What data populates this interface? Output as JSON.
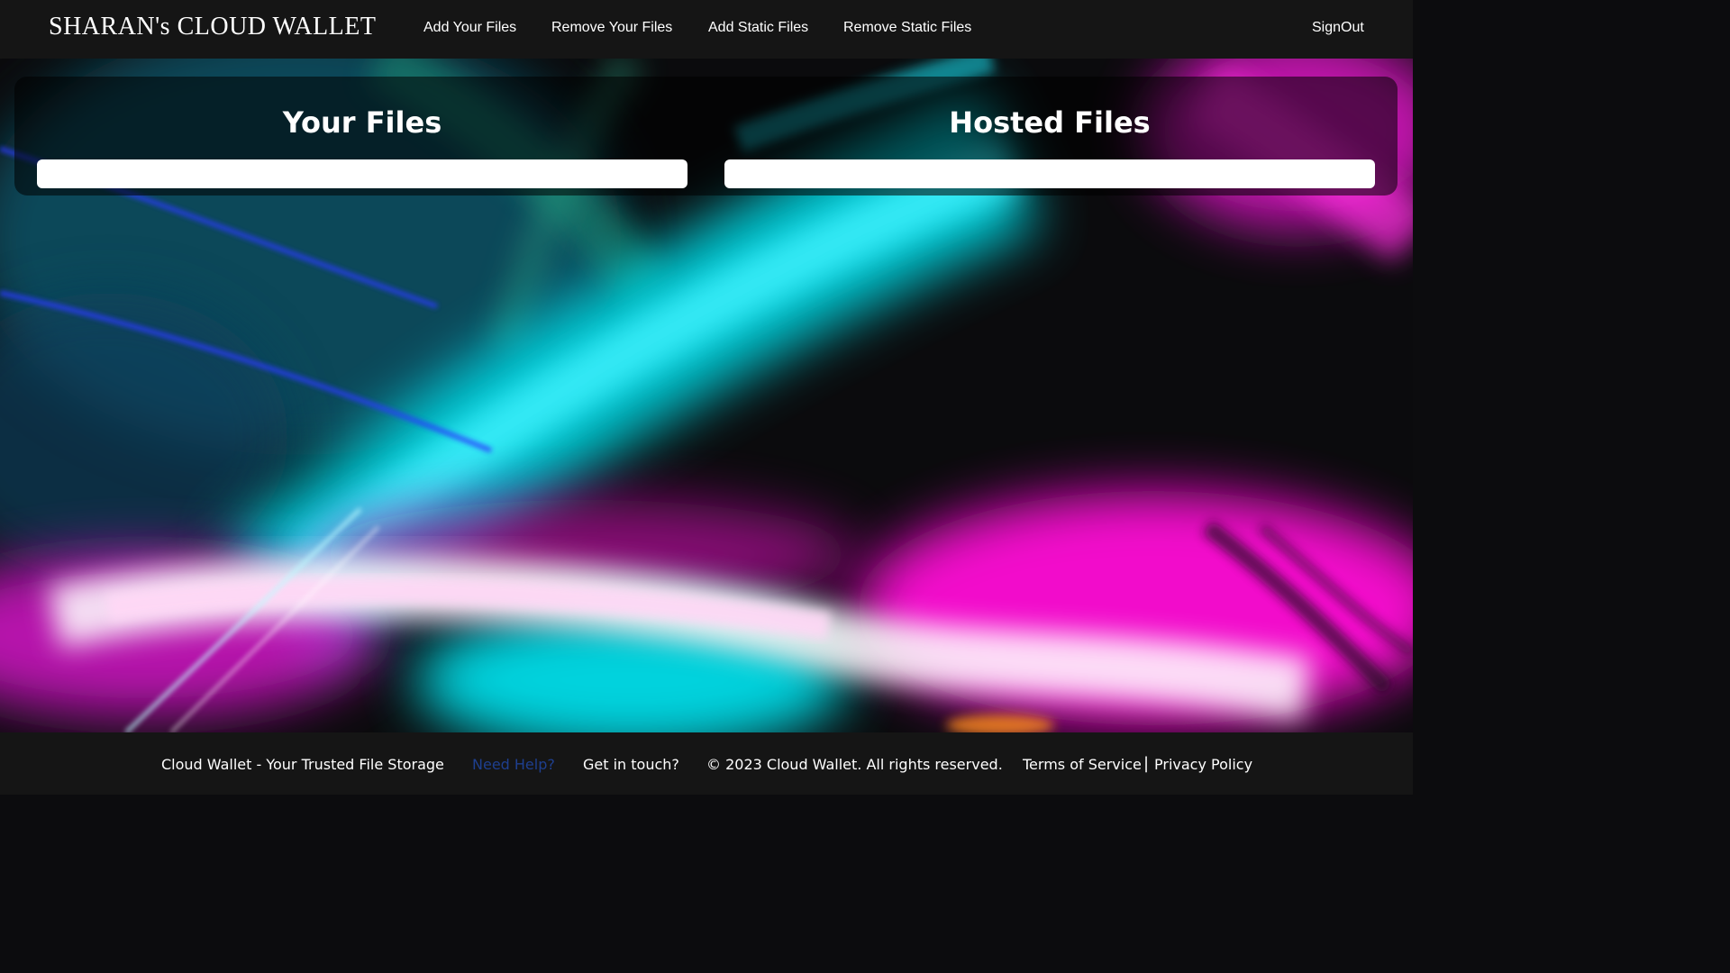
{
  "navbar": {
    "brand": "SHARAN's CLOUD WALLET",
    "links": [
      {
        "label": "Add Your Files"
      },
      {
        "label": "Remove Your Files"
      },
      {
        "label": "Add Static Files"
      },
      {
        "label": "Remove Static Files"
      }
    ],
    "signout_label": "SignOut"
  },
  "main": {
    "your_files_title": "Your Files",
    "hosted_files_title": "Hosted Files"
  },
  "footer": {
    "tagline": "Cloud Wallet - Your Trusted File Storage",
    "help_label": "Need Help?",
    "contact_label": "Get in touch?",
    "copyright": "© 2023 Cloud Wallet. All rights reserved.",
    "terms_label": "Terms of Service",
    "separator": "|",
    "privacy_label": "Privacy Policy"
  },
  "colors": {
    "bar_bg": "#151515",
    "help_link": "#1e3f8f",
    "accent_cyan": "#00e5f0",
    "accent_magenta": "#ff14d8"
  }
}
